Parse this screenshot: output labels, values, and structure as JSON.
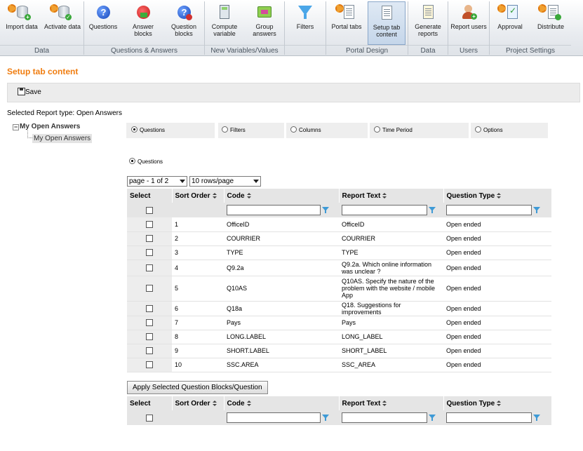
{
  "ribbon": {
    "buttons": [
      {
        "label": "Import data",
        "icon": "import-data-icon"
      },
      {
        "label": "Activate data",
        "icon": "activate-data-icon"
      },
      {
        "label": "Questions",
        "icon": "questions-icon"
      },
      {
        "label": "Answer blocks",
        "icon": "answer-blocks-icon"
      },
      {
        "label": "Question blocks",
        "icon": "question-blocks-icon"
      },
      {
        "label": "Compute variable",
        "icon": "calculator-icon"
      },
      {
        "label": "Group answers",
        "icon": "group-answers-icon"
      },
      {
        "label": "Filters",
        "icon": "filter-funnel-icon"
      },
      {
        "label": "Portal tabs",
        "icon": "portal-tabs-icon"
      },
      {
        "label": "Setup tab content",
        "icon": "setup-tab-content-icon"
      },
      {
        "label": "Generate reports",
        "icon": "generate-reports-icon"
      },
      {
        "label": "Report users",
        "icon": "report-users-icon"
      },
      {
        "label": "Approval",
        "icon": "approval-icon"
      },
      {
        "label": "Distribute",
        "icon": "distribute-icon"
      }
    ],
    "groups": [
      "Data",
      "Questions & Answers",
      "New Variables/Values",
      "Portal Design",
      "Data",
      "Users",
      "Project Settings"
    ]
  },
  "page": {
    "title": "Setup tab content",
    "save_label": "Save",
    "report_type": "Selected Report type: Open Answers"
  },
  "tree": {
    "root": "My Open Answers",
    "child": "My Open Answers"
  },
  "tabs": [
    "Questions",
    "Filters",
    "Columns",
    "Time Period",
    "Options"
  ],
  "selected_tab": "Questions",
  "sub_option": "Questions",
  "pager": {
    "page": "page - 1 of 2",
    "rows": "10 rows/page"
  },
  "table": {
    "headers": [
      "Select",
      "Sort Order",
      "Code",
      "Report Text",
      "Question Type"
    ],
    "rows": [
      {
        "sort": "1",
        "code": "OfficeID",
        "text": "OfficeID",
        "type": "Open ended"
      },
      {
        "sort": "2",
        "code": "COURRIER",
        "text": "COURRIER",
        "type": "Open ended"
      },
      {
        "sort": "3",
        "code": "TYPE",
        "text": "TYPE",
        "type": "Open ended"
      },
      {
        "sort": "4",
        "code": "Q9.2a",
        "text": "Q9.2a. Which online information was unclear ?",
        "type": "Open ended"
      },
      {
        "sort": "5",
        "code": "Q10AS",
        "text": "Q10AS. Specify the nature of the problem with the website / mobile App",
        "type": "Open ended"
      },
      {
        "sort": "6",
        "code": "Q18a",
        "text": "Q18. Suggestions for improvements",
        "type": "Open ended"
      },
      {
        "sort": "7",
        "code": "Pays",
        "text": "Pays",
        "type": "Open ended"
      },
      {
        "sort": "8",
        "code": "LONG.LABEL",
        "text": "LONG_LABEL",
        "type": "Open ended"
      },
      {
        "sort": "9",
        "code": "SHORT.LABEL",
        "text": "SHORT_LABEL",
        "type": "Open ended"
      },
      {
        "sort": "10",
        "code": "SSC.AREA",
        "text": "SSC_AREA",
        "type": "Open ended"
      }
    ]
  },
  "apply_button": "Apply Selected Question Blocks/Question",
  "colors": {
    "accent": "#f07d10",
    "header_bg": "#e5e5e5",
    "ribbon_active": "#c5d6ea"
  }
}
